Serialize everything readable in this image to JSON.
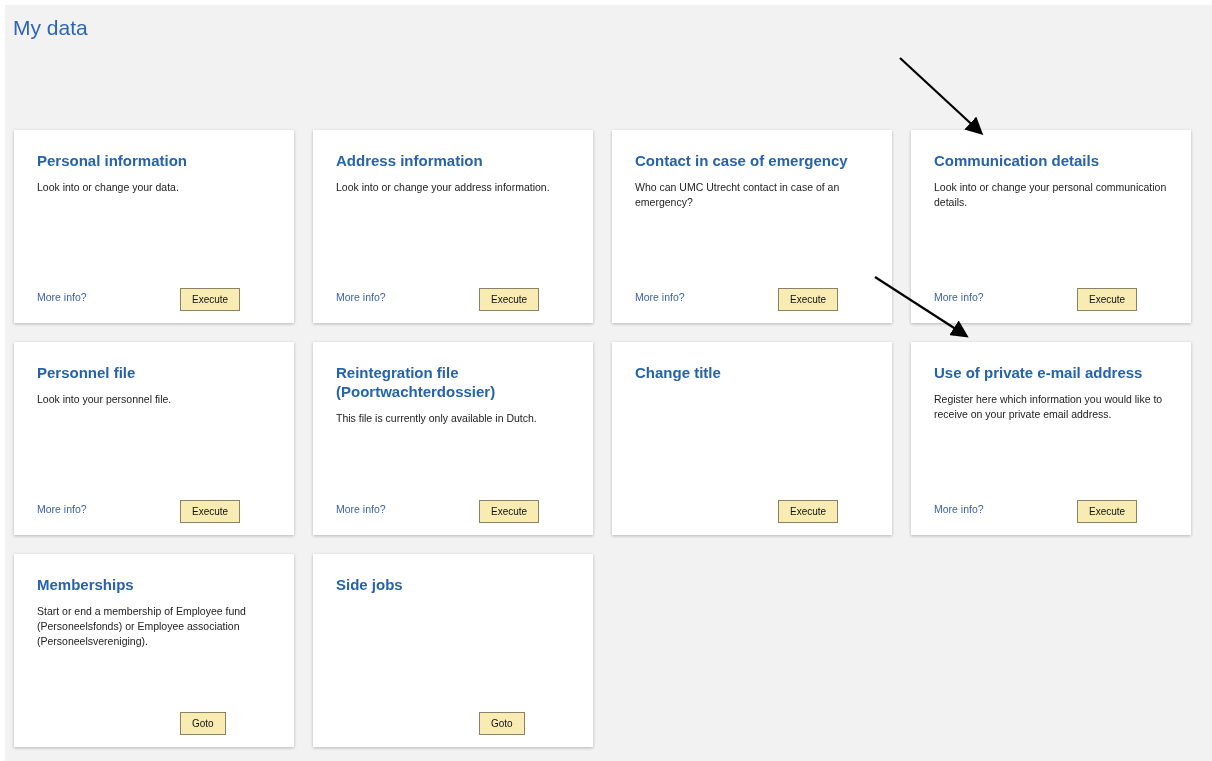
{
  "page_title": "My data",
  "tiles": [
    {
      "title": "Personal information",
      "description": "Look into or change your data.",
      "more_info": "More info?",
      "button": "Execute"
    },
    {
      "title": "Address information",
      "description": "Look into or change your address information.",
      "more_info": "More info?",
      "button": "Execute"
    },
    {
      "title": "Contact in case of emergency",
      "description": "Who can UMC Utrecht contact in case of an emergency?",
      "more_info": "More info?",
      "button": "Execute"
    },
    {
      "title": "Communication details",
      "description": "Look into or change your personal communication details.",
      "more_info": "More info?",
      "button": "Execute"
    },
    {
      "title": "Personnel file",
      "description": "Look into your personnel file.",
      "more_info": "More info?",
      "button": "Execute"
    },
    {
      "title": "Reintegration file (Poortwachterdossier)",
      "description": "This file is currently only available in Dutch.",
      "more_info": "More info?",
      "button": "Execute"
    },
    {
      "title": "Change title",
      "button": "Execute"
    },
    {
      "title": "Use of private e-mail address",
      "description": "Register here which information you would like to receive on your private email address.",
      "more_info": "More info?",
      "button": "Execute"
    },
    {
      "title": "Memberships",
      "description": "Start or end a membership of Employee fund (Personeelsfonds) or Employee association (Personeelsvereniging).",
      "button": "Goto"
    },
    {
      "title": "Side jobs",
      "button": "Goto"
    }
  ]
}
